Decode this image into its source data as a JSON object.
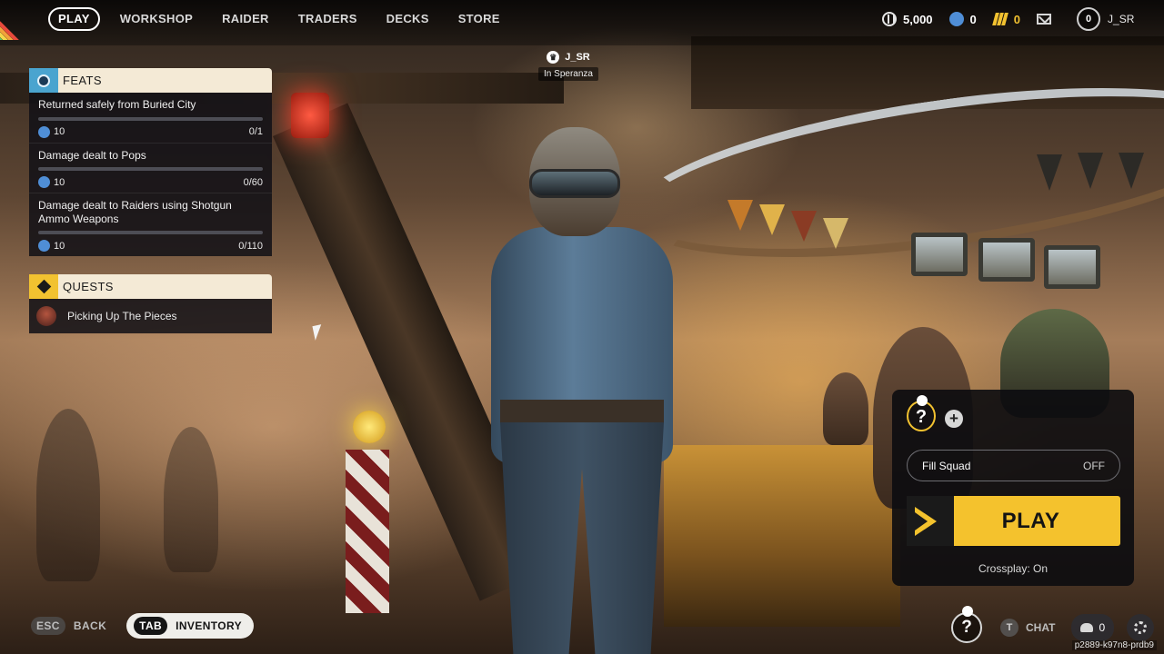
{
  "nav": {
    "items": [
      "PLAY",
      "WORKSHOP",
      "RAIDER",
      "TRADERS",
      "DECKS",
      "STORE"
    ],
    "active": "PLAY"
  },
  "currencies": {
    "coins": "5,000",
    "tokens": "0",
    "cred": "0"
  },
  "user": {
    "level": "0",
    "name": "J_SR"
  },
  "player_tag": {
    "name": "J_SR",
    "location": "In Speranza"
  },
  "feats": {
    "title": "FEATS",
    "items": [
      {
        "title": "Returned safely from Buried City",
        "reward": "10",
        "progress_text": "0/1",
        "progress": 0
      },
      {
        "title": "Damage dealt to Pops",
        "reward": "10",
        "progress_text": "0/60",
        "progress": 0
      },
      {
        "title": "Damage dealt to Raiders using Shotgun Ammo Weapons",
        "reward": "10",
        "progress_text": "0/110",
        "progress": 0
      }
    ]
  },
  "quests": {
    "title": "QUESTS",
    "items": [
      {
        "label": "Picking Up The Pieces"
      }
    ]
  },
  "squad": {
    "slot_glyph": "?",
    "add_glyph": "+",
    "fill_label": "Fill Squad",
    "fill_state": "OFF",
    "play_label": "PLAY",
    "crossplay": "Crossplay: On"
  },
  "bottom": {
    "back_key": "ESC",
    "back_label": "BACK",
    "inventory_key": "TAB",
    "inventory_label": "INVENTORY",
    "slot_glyph": "?",
    "chat_key": "T",
    "chat_label": "CHAT",
    "friends_count": "0",
    "build_id": "p2889-k97n8-prdb9"
  },
  "colors": {
    "accent_yellow": "#f4c22d",
    "panel_header": "#f4ead6",
    "feats_icon": "#4aa4cf",
    "panel_bg": "#121016"
  },
  "icons": [
    "coin-icon",
    "token-icon",
    "cred-icon",
    "mail-icon",
    "crown-icon",
    "feats-icon",
    "quests-icon",
    "add-icon",
    "play-chevron-icon",
    "friends-icon",
    "gear-icon"
  ]
}
